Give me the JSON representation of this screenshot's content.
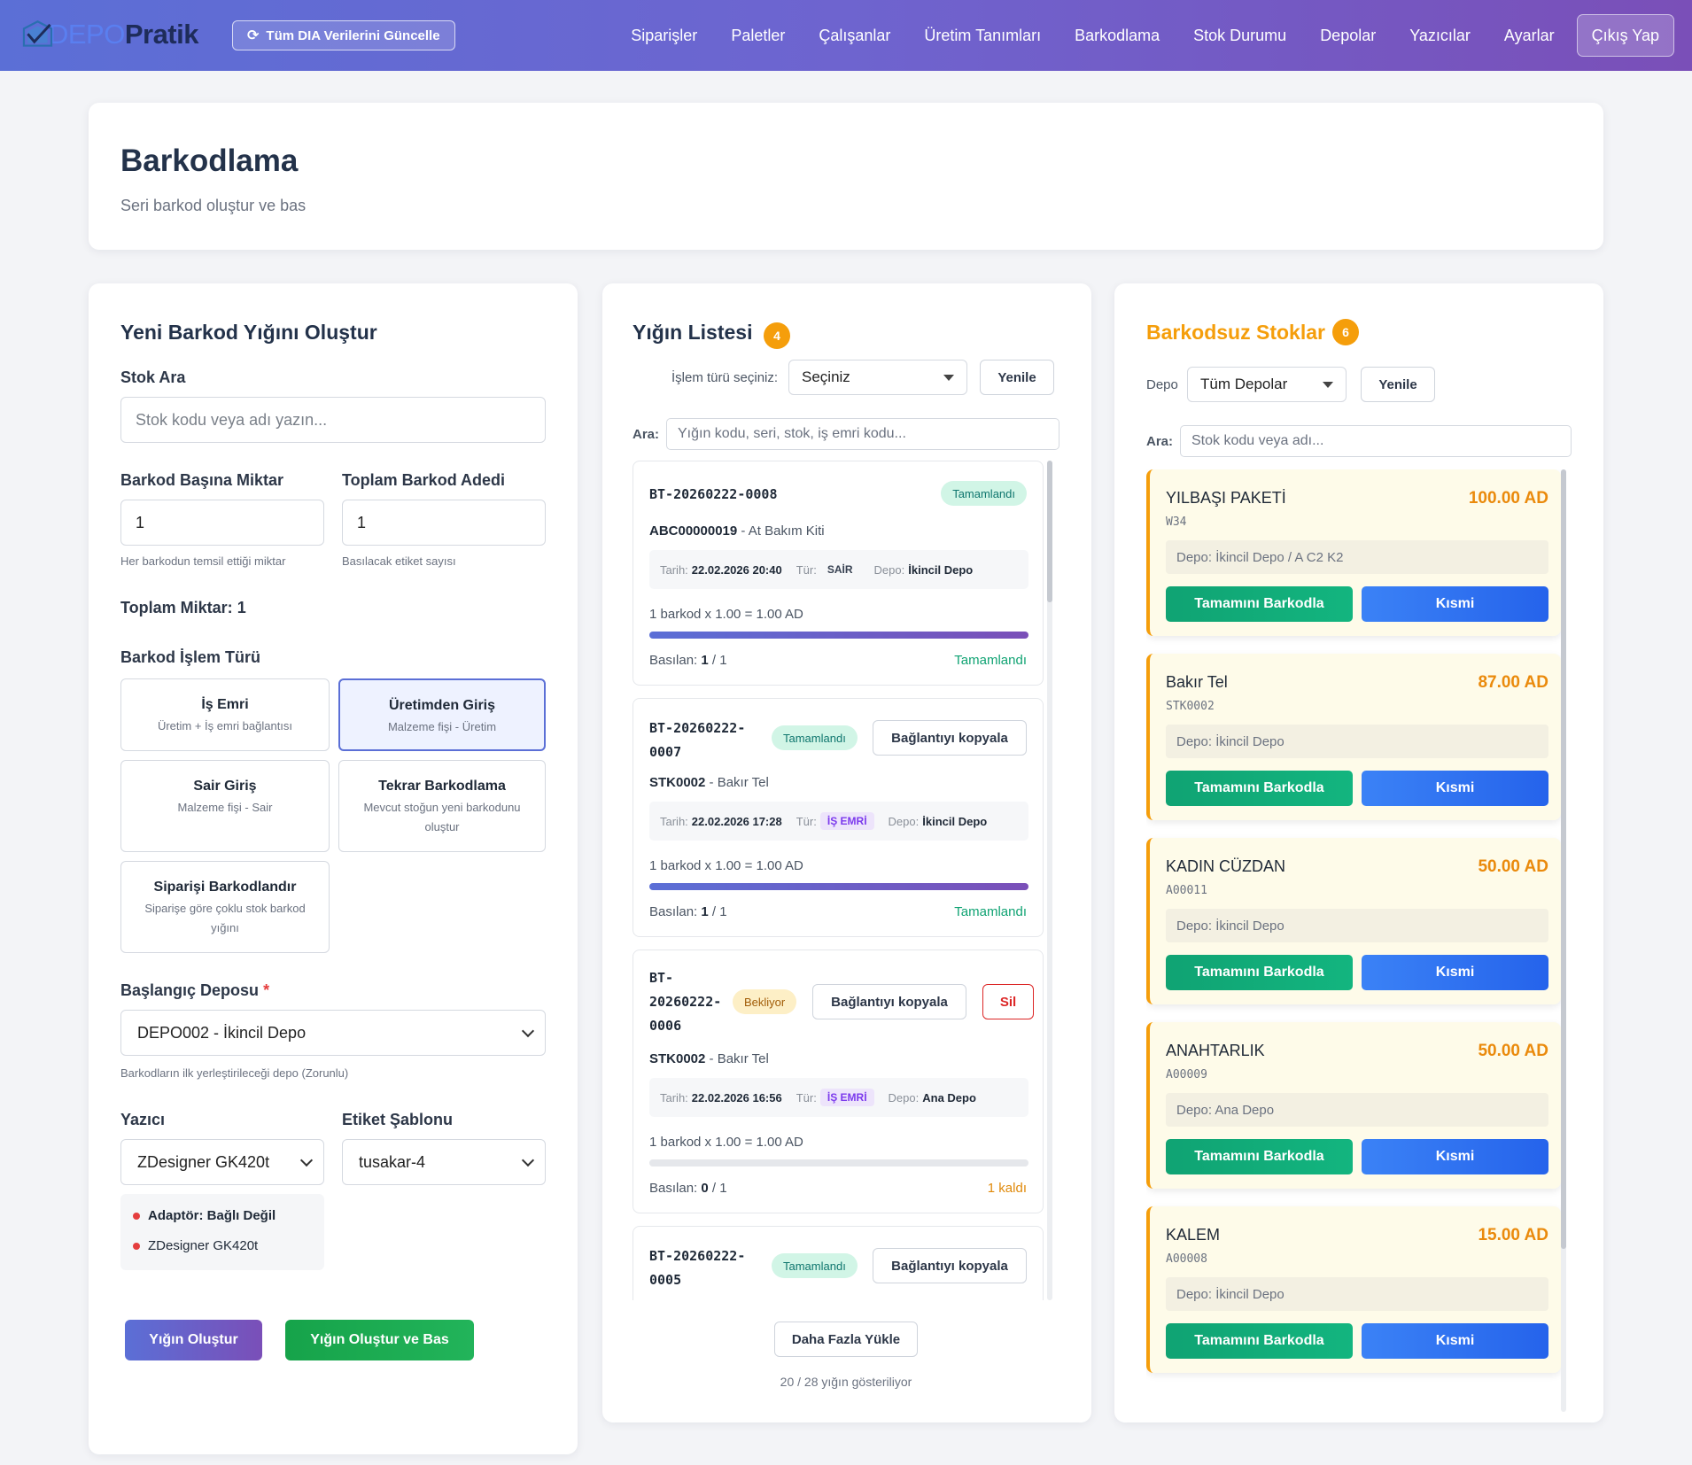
{
  "nav": {
    "logo_part1": "DEPO",
    "logo_part2": "Pratik",
    "sync_label": "Tüm DIA Verilerini Güncelle",
    "links": [
      "Siparişler",
      "Paletler",
      "Çalışanlar",
      "Üretim Tanımları",
      "Barkodlama",
      "Stok Durumu",
      "Depolar",
      "Yazıcılar",
      "Ayarlar"
    ],
    "logout": "Çıkış Yap"
  },
  "header": {
    "title": "Barkodlama",
    "subtitle": "Seri barkod oluştur ve bas"
  },
  "create": {
    "title": "Yeni Barkod Yığını Oluştur",
    "stock_search_label": "Stok Ara",
    "stock_search_placeholder": "Stok kodu veya adı yazın...",
    "per_barcode_label": "Barkod Başına Miktar",
    "per_barcode_value": "1",
    "per_barcode_hint": "Her barkodun temsil ettiği miktar",
    "total_count_label": "Toplam Barkod Adedi",
    "total_count_value": "1",
    "total_count_hint": "Basılacak etiket sayısı",
    "total_qty_label": "Toplam Miktar:",
    "total_qty_value": "1",
    "op_type_label": "Barkod İşlem Türü",
    "op_types": [
      {
        "title": "İş Emri",
        "desc": "Üretim + İş emri bağlantısı"
      },
      {
        "title": "Üretimden Giriş",
        "desc": "Malzeme fişi - Üretim"
      },
      {
        "title": "Sair Giriş",
        "desc": "Malzeme fişi - Sair"
      },
      {
        "title": "Tekrar Barkodlama",
        "desc": "Mevcut stoğun yeni barkodunu oluştur"
      },
      {
        "title": "Siparişi Barkodlandır",
        "desc": "Siparişe göre çoklu stok barkod yığını"
      }
    ],
    "start_depot_label": "Başlangıç Deposu",
    "required_mark": "*",
    "start_depot_value": "DEPO002 - İkincil Depo",
    "start_depot_hint": "Barkodların ilk yerleştirileceği depo (Zorunlu)",
    "printer_label": "Yazıcı",
    "printer_value": "ZDesigner GK420t",
    "template_label": "Etiket Şablonu",
    "template_value": "tusakar-4",
    "adapter_status": "Adaptör: Bağlı Değil",
    "adapter_printer": "ZDesigner GK420t",
    "create_btn": "Yığın Oluştur",
    "create_print_btn": "Yığın Oluştur ve Bas"
  },
  "batches": {
    "title": "Yığın Listesi",
    "count": "4",
    "op_filter_label": "İşlem türü seçiniz:",
    "op_filter_value": "Seçiniz",
    "refresh": "Yenile",
    "search_label": "Ara:",
    "search_placeholder": "Yığın kodu, seri, stok, iş emri kodu...",
    "copy_link": "Bağlantıyı kopyala",
    "delete": "Sil",
    "date_label": "Tarih:",
    "type_label": "Tür:",
    "depot_label": "Depo:",
    "printed_label": "Basılan:",
    "items": [
      {
        "code": "BT-20260222-0008",
        "status": "Tamamlandı",
        "stock_code": "ABC00000019",
        "stock_name": "- At Bakım Kiti",
        "date": "22.02.2026 20:40",
        "type": "SAİR",
        "depot": "İkincil Depo",
        "calc": "1 barkod x 1.00 = 1.00 AD",
        "progress": 1.0,
        "printed": "1",
        "total": "/ 1",
        "state": "Tamamlandı"
      },
      {
        "code_l1": "BT-20260222-",
        "code_l2": "0007",
        "status": "Tamamlandı",
        "stock_code": "STK0002",
        "stock_name": "- Bakır Tel",
        "date": "22.02.2026 17:28",
        "type": "İŞ EMRİ",
        "depot": "İkincil Depo",
        "calc": "1 barkod x 1.00 = 1.00 AD",
        "progress": 1.0,
        "printed": "1",
        "total": "/ 1",
        "state": "Tamamlandı"
      },
      {
        "code_l1": "BT-",
        "code_l2": "20260222-",
        "code_l3": "0006",
        "status": "Bekliyor",
        "stock_code": "STK0002",
        "stock_name": "- Bakır Tel",
        "date": "22.02.2026 16:56",
        "type": "İŞ EMRİ",
        "depot": "Ana Depo",
        "calc": "1 barkod x 1.00 = 1.00 AD",
        "progress": 0.0,
        "printed": "0",
        "total": "/ 1",
        "state": "1 kaldı"
      },
      {
        "code_l1": "BT-20260222-",
        "code_l2": "0005",
        "status": "Tamamlandı"
      }
    ],
    "load_more": "Daha Fazla Yükle",
    "shown_info": "20 / 28 yığın gösteriliyor"
  },
  "unbarcoded": {
    "title": "Barkodsuz Stoklar",
    "count": "6",
    "depot_label": "Depo",
    "depot_value": "Tüm Depolar",
    "refresh": "Yenile",
    "search_label": "Ara:",
    "search_placeholder": "Stok kodu veya adı...",
    "full_btn": "Tamamını Barkodla",
    "part_btn": "Kısmi",
    "items": [
      {
        "name": "YILBAŞI PAKETİ",
        "code": "W34",
        "qty": "100.00 AD",
        "depot": "Depo: İkincil Depo / A C2 K2"
      },
      {
        "name": "Bakır Tel",
        "code": "STK0002",
        "qty": "87.00 AD",
        "depot": "Depo: İkincil Depo"
      },
      {
        "name": "KADIN CÜZDAN",
        "code": "A00011",
        "qty": "50.00 AD",
        "depot": "Depo: İkincil Depo"
      },
      {
        "name": "ANAHTARLIK",
        "code": "A00009",
        "qty": "50.00 AD",
        "depot": "Depo: Ana Depo"
      },
      {
        "name": "KALEM",
        "code": "A00008",
        "qty": "15.00 AD",
        "depot": "Depo: İkincil Depo"
      }
    ]
  },
  "colors": {
    "nav_start": "#5b6fd6",
    "nav_end": "#7a4fb8",
    "accent_orange": "#f59e0b",
    "success": "#10a373",
    "primary_blue": "#2563eb",
    "danger": "#dc2626"
  }
}
